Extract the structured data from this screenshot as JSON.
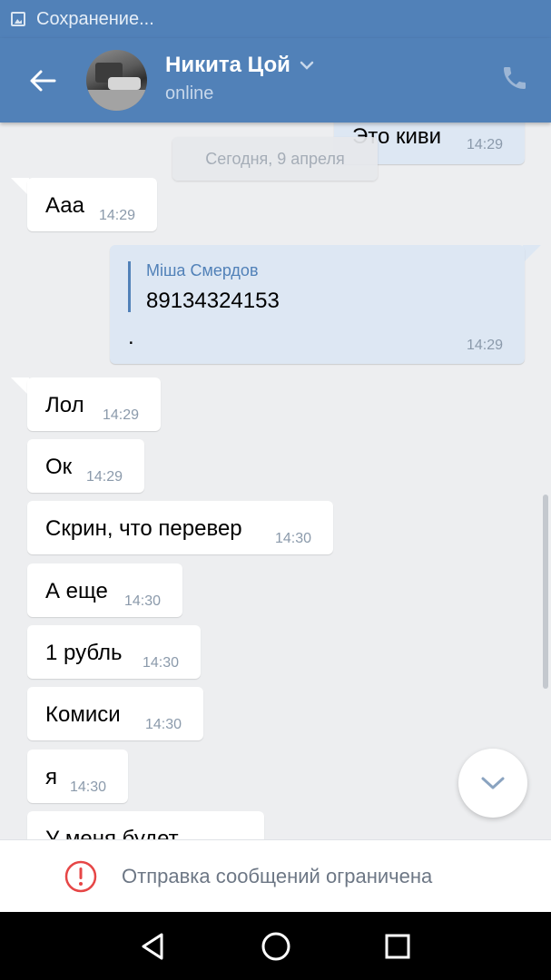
{
  "status_bar": {
    "notification": "Сохранение..."
  },
  "header": {
    "contact_name": "Никита Цой",
    "contact_status": "online",
    "colors": {
      "header_bg": "#5181b8",
      "accent": "#5181b8"
    }
  },
  "chat": {
    "date_separator": "Сегодня, 9 апреля",
    "messages": [
      {
        "direction": "out",
        "text": "Это киви",
        "time": "14:29"
      },
      {
        "direction": "in",
        "text": "Ааа",
        "time": "14:29"
      },
      {
        "direction": "out",
        "forwarded_from": "Міша Смердов",
        "forwarded_text": "89134324153",
        "text": ".",
        "time": "14:29"
      },
      {
        "direction": "in",
        "text": "Лол",
        "time": "14:29"
      },
      {
        "direction": "in",
        "text": "Ок",
        "time": "14:29"
      },
      {
        "direction": "in",
        "text": "Скрин, что перевер",
        "time": "14:30"
      },
      {
        "direction": "in",
        "text": "А еще",
        "time": "14:30"
      },
      {
        "direction": "in",
        "text": "1 рубль",
        "time": "14:30"
      },
      {
        "direction": "in",
        "text": "Комиси",
        "time": "14:30"
      },
      {
        "direction": "in",
        "text": "я",
        "time": "14:30"
      },
      {
        "direction": "in",
        "text": "У меня будет",
        "time": ""
      }
    ]
  },
  "restriction": {
    "text": "Отправка сообщений ограничена",
    "icon": "warning-circle-icon",
    "color": "#e64646"
  },
  "icons": {
    "back": "arrow-left-icon",
    "dropdown": "chevron-down-icon",
    "call": "phone-icon",
    "scroll_down": "chevron-down-icon",
    "nav_back": "triangle-back-icon",
    "nav_home": "circle-home-icon",
    "nav_recents": "square-recents-icon"
  }
}
